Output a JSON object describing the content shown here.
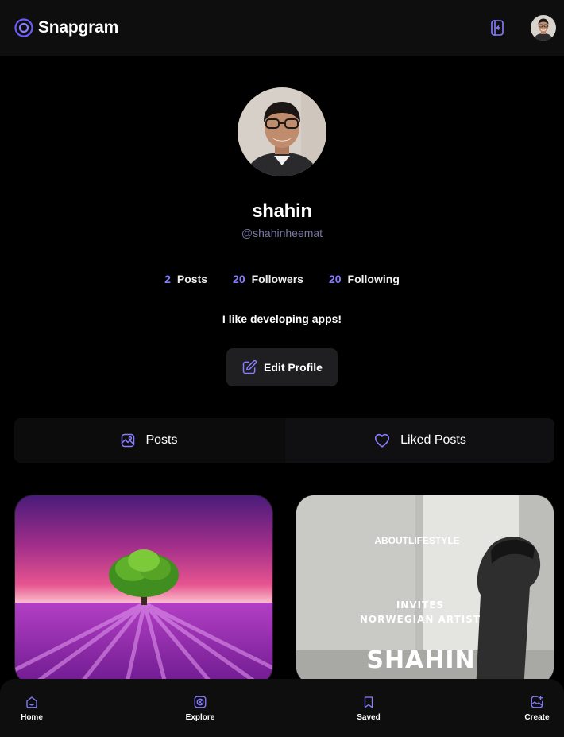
{
  "app": {
    "name": "Snapgram",
    "accent": "#877eff"
  },
  "header": {
    "logout_icon": "logout-icon",
    "avatar_alt": "user avatar"
  },
  "profile": {
    "name": "shahin",
    "handle": "@shahinheemat",
    "stats": [
      {
        "value": "2",
        "label": "Posts"
      },
      {
        "value": "20",
        "label": "Followers"
      },
      {
        "value": "20",
        "label": "Following"
      }
    ],
    "bio": "I like developing apps!",
    "edit_label": "Edit Profile"
  },
  "tabs": [
    {
      "label": "Posts",
      "icon": "image-icon",
      "active": true
    },
    {
      "label": "Liked Posts",
      "icon": "heart-icon",
      "active": false
    }
  ],
  "posts": [
    {
      "kind": "photo",
      "description": "tree in lavender field"
    },
    {
      "kind": "poster",
      "line1": "ABOUTLIFESTYLE",
      "line2": "INVITES",
      "line3": "NORWEGIAN ARTIST",
      "line4": "SHAHIN"
    }
  ],
  "bottom_nav": [
    {
      "label": "Home",
      "icon": "home-icon"
    },
    {
      "label": "Explore",
      "icon": "explore-icon"
    },
    {
      "label": "Saved",
      "icon": "bookmark-icon"
    },
    {
      "label": "Create",
      "icon": "create-icon"
    }
  ]
}
